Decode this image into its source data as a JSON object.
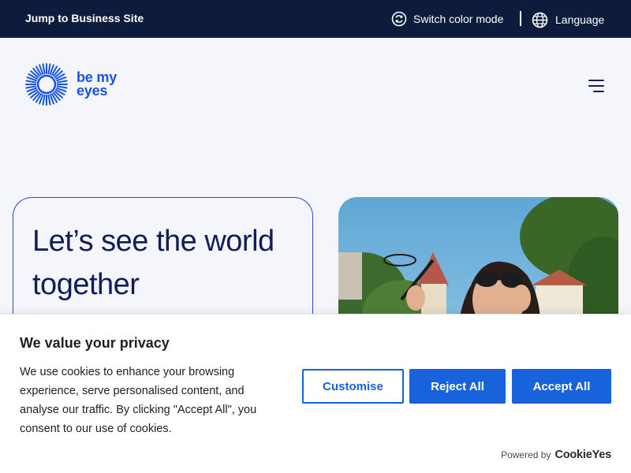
{
  "topbar": {
    "business_link": "Jump to Business Site",
    "color_mode": "Switch color mode",
    "language": "Language"
  },
  "header": {
    "logo_line1": "be my",
    "logo_line2": "eyes"
  },
  "hero": {
    "headline": "Let’s see the world together"
  },
  "cookie_banner": {
    "title": "We value your privacy",
    "body": "We use cookies to enhance your browsing experience, serve personalised content, and analyse our traffic. By clicking \"Accept All\", you consent to our use of cookies.",
    "customise_label": "Customise",
    "reject_label": "Reject All",
    "accept_label": "Accept All",
    "powered_by": "Powered by",
    "powered_brand": "CookieYes"
  },
  "colors": {
    "topbar_bg": "#0d1b3c",
    "brand_blue": "#1753e0",
    "cookie_button_blue": "#1863dc",
    "headline_navy": "#0f1e5a",
    "page_bg": "#f5f6fc"
  },
  "icons": [
    "color-mode-icon",
    "globe-icon",
    "be-my-eyes-logo",
    "hamburger-menu-icon"
  ]
}
